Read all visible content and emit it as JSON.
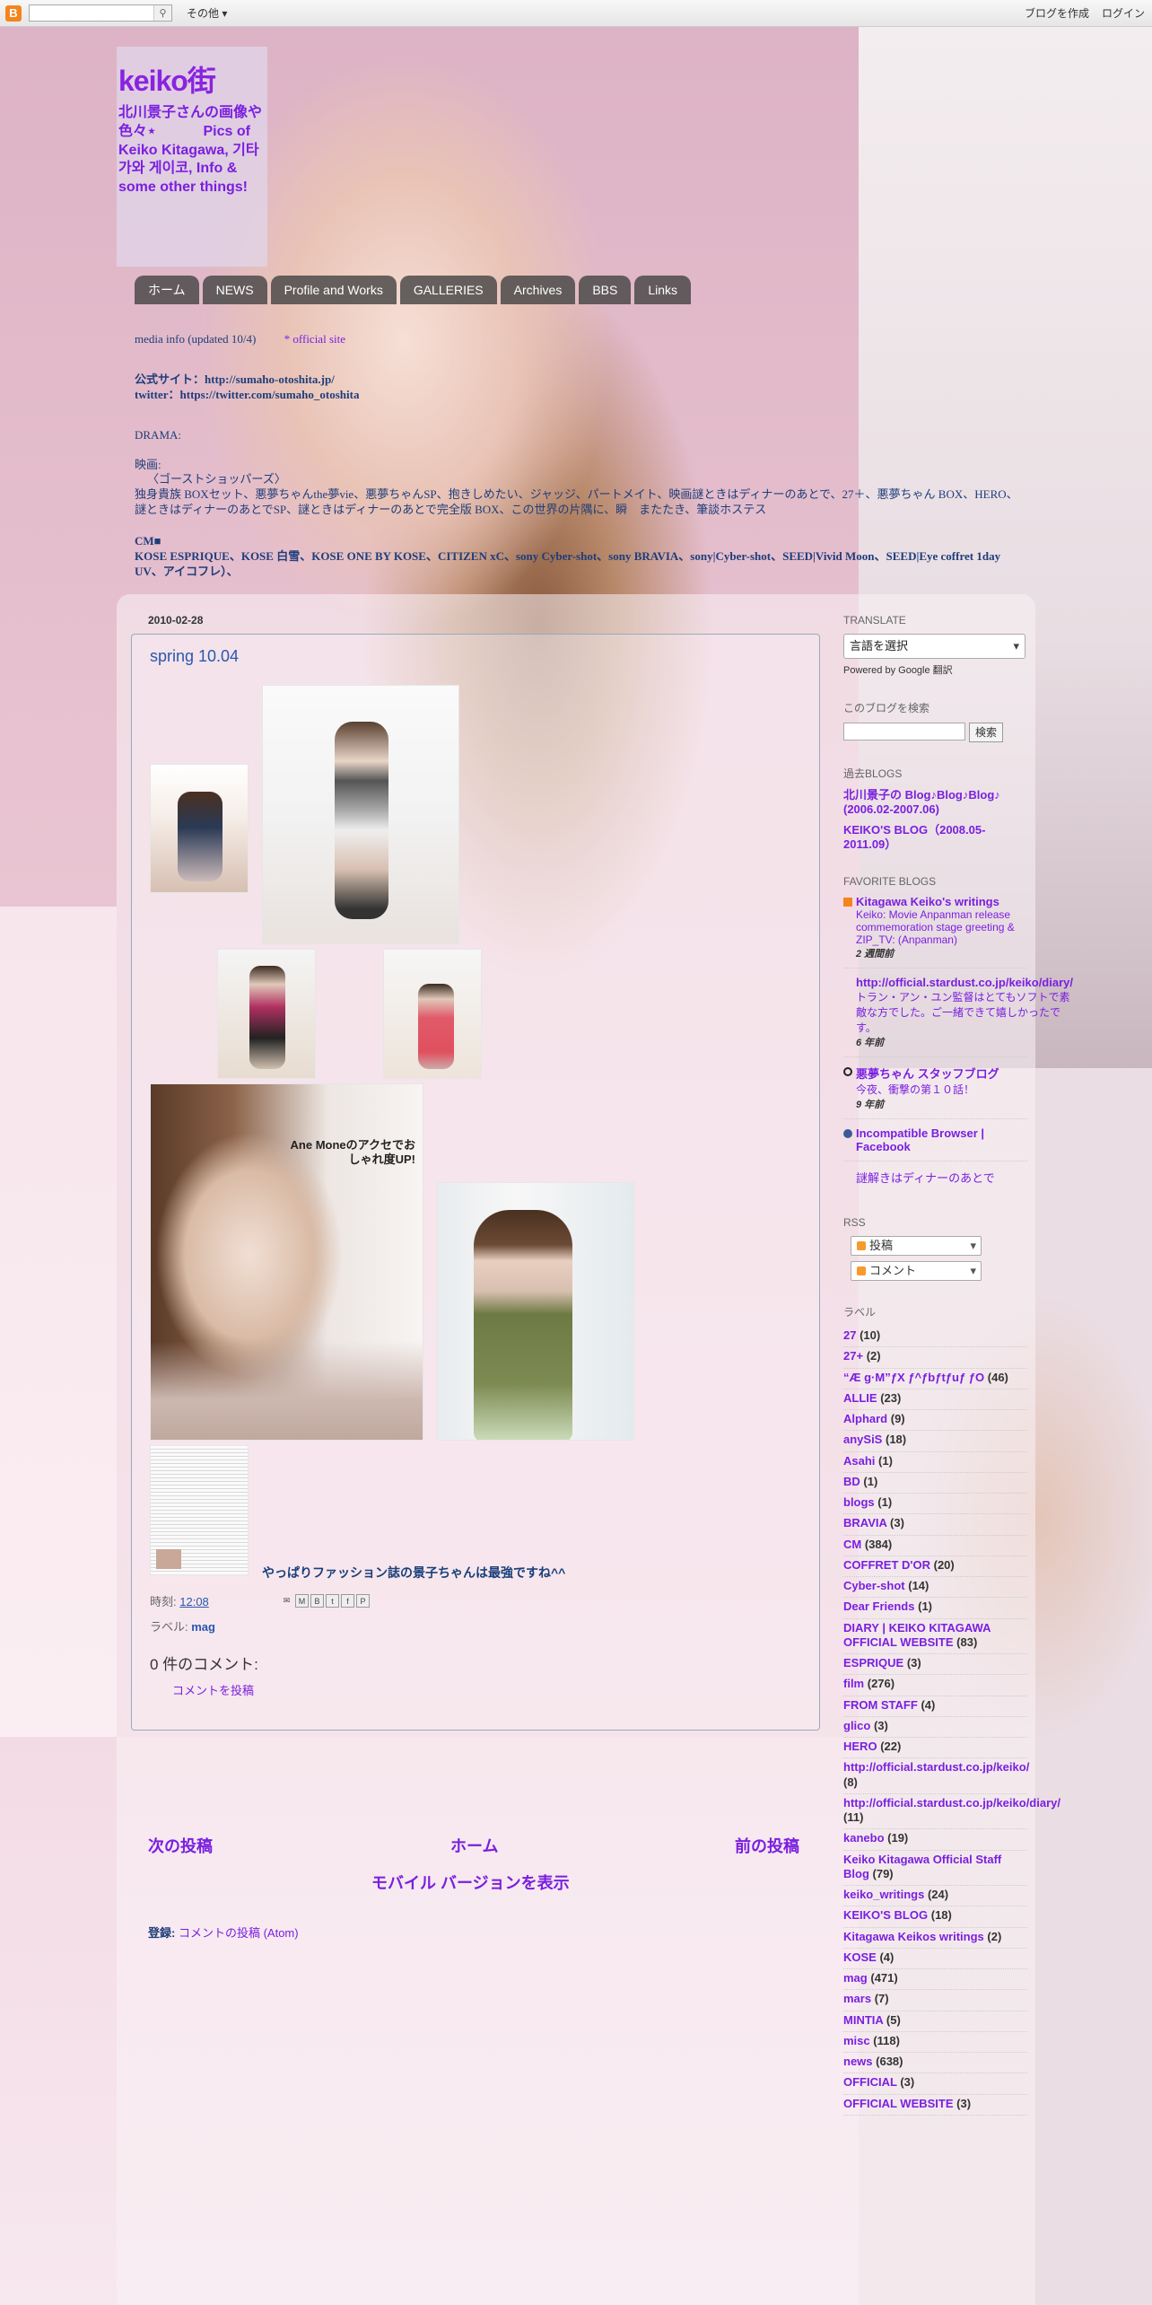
{
  "navbar": {
    "more": "その他 ▾",
    "create_blog": "ブログを作成",
    "login": "ログイン"
  },
  "header": {
    "title": "keiko街",
    "description": "北川景子さんの画像や色々⋆　　　 Pics of Keiko Kitagawa, 기타가와 게이코, Info & some other things!"
  },
  "tabs": [
    "ホーム",
    "NEWS",
    "Profile and Works",
    "GALLERIES",
    "Archives",
    "BBS",
    "Links"
  ],
  "info": {
    "line1": "media info (updated 10/4)",
    "line1_link": "* official site",
    "line2_a": "公式サイト：http://sumaho-otoshita.jp/",
    "line2_b": "twitter：https://twitter.com/sumaho_otoshita",
    "line3": "DRAMA:",
    "line4": "映画:",
    "line5": "〈ゴーストショッパーズ〉",
    "line6": "独身貴族 BOXセット、悪夢ちゃんthe夢vie、悪夢ちゃんSP、抱きしめたい、ジャッジ、パートメイト、映画謎ときはディナーのあとで、27＋、悪夢ちゃん BOX、HERO、謎ときはディナーのあとでSP、謎ときはディナーのあとで完全版 BOX、この世界の片隅に、瞬　またたき、筆談ホステス",
    "line7": "CM■",
    "line8": "KOSE ESPRIQUE、KOSE 白雪、KOSE ONE BY KOSE、CITIZEN xC、sony Cyber-shot、sony BRAVIA、sony|Cyber-shot、SEED|Vivid Moon、SEED|Eye coffret 1day UV、アイコフレ）、"
  },
  "post": {
    "date": "2010-02-28",
    "title": "spring 10.04",
    "body": "やっぱりファッション誌の景子ちゃんは最強ですね^^",
    "time_label": "時刻:",
    "time": "12:08",
    "labels_label": "ラベル:",
    "label": "mag",
    "comments_heading": "0 件のコメント:",
    "post_comment": "コメントを投稿",
    "photo1_caption": "Ane Moneのアクセでおしゃれ度UP!"
  },
  "pager": {
    "newer": "次の投稿",
    "home": "ホーム",
    "older": "前の投稿",
    "mobile": "モバイル バージョンを表示"
  },
  "subscribe": {
    "label": "登録:",
    "link": "コメントの投稿 (Atom)"
  },
  "sidebar": {
    "translate_heading": "TRANSLATE",
    "translate_select": "言語を選択",
    "powered_by": "Powered by Google 翻訳",
    "search_heading": "このブログを検索",
    "search_button": "検索",
    "past_heading": "過去BLOGS",
    "past": [
      "北川景子の Blog♪Blog♪Blog♪ (2006.02-2007.06)",
      "KEIKO'S BLOG（2008.05-2011.09）"
    ],
    "fav_heading": "FAVORITE BLOGS",
    "favorites": [
      {
        "title": "Kitagawa Keiko's writings",
        "snippet": "Keiko: Movie Anpanman release commemoration stage greeting & ZIP_TV: (Anpanman)",
        "time": "2 週間前"
      },
      {
        "title": "http://official.stardust.co.jp/keiko/diary/",
        "snippet": "トラン・アン・ユン監督はとてもソフトで素敵な方でした。ご一緒できて嬉しかったです。",
        "time": "6 年前"
      },
      {
        "title": "悪夢ちゃん スタッフブログ",
        "snippet": "今夜、衝撃の第１０話！",
        "time": "9 年前"
      },
      {
        "title": "Incompatible Browser | Facebook",
        "snippet": "",
        "time": ""
      },
      {
        "title": "謎解きはディナーのあとで",
        "snippet": "",
        "time": ""
      }
    ],
    "rss_heading": "RSS",
    "rss": [
      "投稿",
      "コメント"
    ],
    "labels_heading": "ラベル",
    "labels": [
      {
        "name": "27",
        "count": "(10)"
      },
      {
        "name": "27+",
        "count": "(2)"
      },
      {
        "name": "“Æ g·M”ƒX ƒ^ƒbƒtƒuƒ ƒO",
        "count": "(46)"
      },
      {
        "name": "ALLIE",
        "count": "(23)"
      },
      {
        "name": "Alphard",
        "count": "(9)"
      },
      {
        "name": "anySiS",
        "count": "(18)"
      },
      {
        "name": "Asahi",
        "count": "(1)"
      },
      {
        "name": "BD",
        "count": "(1)"
      },
      {
        "name": "blogs",
        "count": "(1)"
      },
      {
        "name": "BRAVIA",
        "count": "(3)"
      },
      {
        "name": "CM",
        "count": "(384)"
      },
      {
        "name": "COFFRET D'OR",
        "count": "(20)"
      },
      {
        "name": "Cyber-shot",
        "count": "(14)"
      },
      {
        "name": "Dear Friends",
        "count": "(1)"
      },
      {
        "name": "DIARY | KEIKO KITAGAWA OFFICIAL WEBSITE",
        "count": "(83)"
      },
      {
        "name": "ESPRIQUE",
        "count": "(3)"
      },
      {
        "name": "film",
        "count": "(276)"
      },
      {
        "name": "FROM STAFF",
        "count": "(4)"
      },
      {
        "name": "glico",
        "count": "(3)"
      },
      {
        "name": "HERO",
        "count": "(22)"
      },
      {
        "name": "http://official.stardust.co.jp/keiko/",
        "count": "(8)"
      },
      {
        "name": "http://official.stardust.co.jp/keiko/diary/",
        "count": "(11)"
      },
      {
        "name": "kanebo",
        "count": "(19)"
      },
      {
        "name": "Keiko Kitagawa Official Staff Blog",
        "count": "(79)"
      },
      {
        "name": "keiko_writings",
        "count": "(24)"
      },
      {
        "name": "KEIKO'S BLOG",
        "count": "(18)"
      },
      {
        "name": "Kitagawa Keikos writings",
        "count": "(2)"
      },
      {
        "name": "KOSE",
        "count": "(4)"
      },
      {
        "name": "mag",
        "count": "(471)"
      },
      {
        "name": "mars",
        "count": "(7)"
      },
      {
        "name": "MINTIA",
        "count": "(5)"
      },
      {
        "name": "misc",
        "count": "(118)"
      },
      {
        "name": "news",
        "count": "(638)"
      },
      {
        "name": "OFFICIAL",
        "count": "(3)"
      },
      {
        "name": "OFFICIAL WEBSITE",
        "count": "(3)"
      }
    ]
  }
}
